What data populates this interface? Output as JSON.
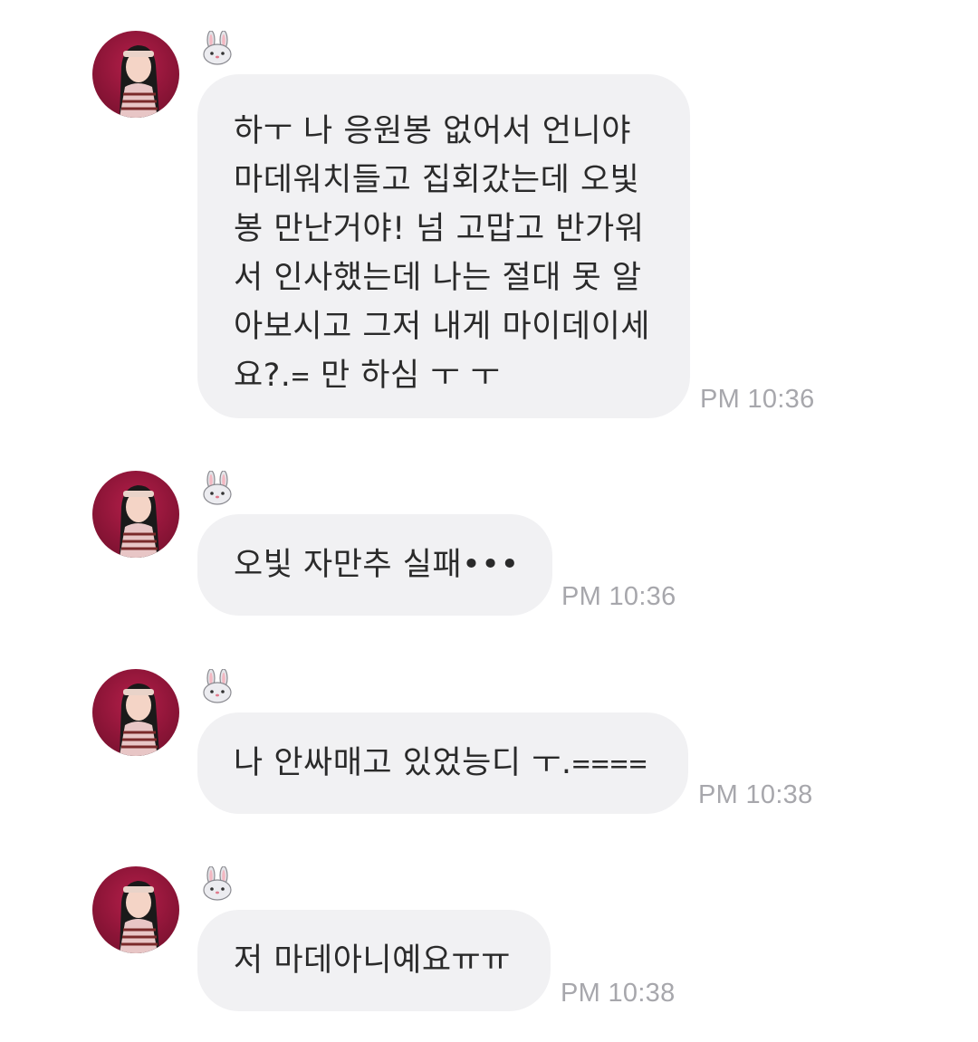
{
  "conversation": {
    "messages": [
      {
        "sender_emoji": "🐰",
        "avatar_icon": "profile-photo-icon",
        "text": "하ㅜ 나 응원봉 없어서 언니야\n마데워치들고 집회갔는데 오빛\n봉 만난거야! 넘 고맙고 반가워\n서 인사했는데 나는 절대 못 알\n아보시고 그저 내게 마이데이세\n요?.᐀ 만 하심 ㅜ ㅜ",
        "time": "PM 10:36"
      },
      {
        "sender_emoji": "🐰",
        "avatar_icon": "profile-photo-icon",
        "text": "오빛 자만추 실패•••",
        "time": "PM 10:36"
      },
      {
        "sender_emoji": "🐰",
        "avatar_icon": "profile-photo-icon",
        "text": "나 안싸매고 있었능디 ㅜ.᐀᐀᐀᐀",
        "time": "PM 10:38"
      },
      {
        "sender_emoji": "🐰",
        "avatar_icon": "profile-photo-icon",
        "text": "저 마데아니예요ㅠㅠ",
        "time": "PM 10:38"
      }
    ]
  },
  "colors": {
    "bubble_background": "#f1f1f3",
    "text": "#2a2a2a",
    "timestamp": "#a7a7ac",
    "avatar_background": "#9b1a40"
  }
}
